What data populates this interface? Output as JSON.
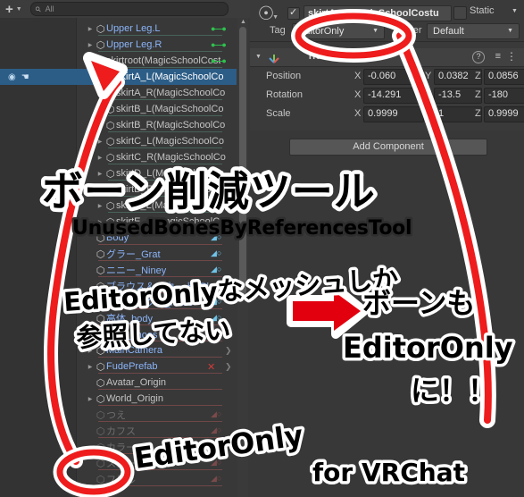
{
  "app": {
    "editor": "Unity Editor",
    "background": "#3a3a3a"
  },
  "hierarchy": {
    "toolbar": {
      "add_label": "+",
      "add_caret": "▼",
      "search_placeholder": "All",
      "search_value": ""
    },
    "scroll": {
      "up_arrow": "▲"
    },
    "rows": [
      {
        "label": "Upper Leg.L",
        "indent": 1,
        "tri": "▶",
        "color": "blue",
        "badge": "bone",
        "line": "teal"
      },
      {
        "label": "Upper Leg.R",
        "indent": 1,
        "tri": "▶",
        "color": "blue",
        "badge": "bone",
        "line": "teal"
      },
      {
        "label": "skirtroot(MagicSchoolCost",
        "indent": 1,
        "tri": "▼",
        "color": "normal",
        "badge": "bone",
        "line": "teal"
      },
      {
        "label": "skirtA_L(MagicSchoolCo",
        "indent": 2,
        "tri": "",
        "color": "selected",
        "badge": "",
        "line": "teal"
      },
      {
        "label": "skirtA_R(MagicSchoolCo",
        "indent": 2,
        "tri": "",
        "color": "normal",
        "badge": "",
        "line": "teal"
      },
      {
        "label": "skirtB_L(MagicSchoolCo",
        "indent": 2,
        "tri": "",
        "color": "normal",
        "badge": "",
        "line": "teal"
      },
      {
        "label": "skirtB_R(MagicSchoolCo",
        "indent": 2,
        "tri": "▶",
        "color": "normal",
        "badge": "",
        "line": "teal"
      },
      {
        "label": "skirtC_L(MagicSchoolCo",
        "indent": 2,
        "tri": "▶",
        "color": "normal",
        "badge": "",
        "line": "teal"
      },
      {
        "label": "skirtC_R(MagicSchoolCo",
        "indent": 2,
        "tri": "▶",
        "color": "normal",
        "badge": "",
        "line": "teal"
      },
      {
        "label": "skirtD_L(MagicSchoolCo",
        "indent": 2,
        "tri": "▶",
        "color": "normal",
        "badge": "",
        "line": "teal"
      },
      {
        "label": "skirtD_R(MagicSchoolCo",
        "indent": 2,
        "tri": "▶",
        "color": "normal",
        "badge": "",
        "line": "teal"
      },
      {
        "label": "skirtE_L(MagicSchoolCo",
        "indent": 2,
        "tri": "▶",
        "color": "normal",
        "badge": "",
        "line": "teal"
      },
      {
        "label": "skirtE_R(MagicSchoolCo",
        "indent": 2,
        "tri": "▶",
        "color": "normal",
        "badge": "",
        "line": "teal"
      },
      {
        "label": "Body",
        "indent": 1,
        "tri": "",
        "color": "blue",
        "badge": "skin",
        "line": "red"
      },
      {
        "label": "グラー_Grat",
        "indent": 1,
        "tri": "",
        "color": "blue",
        "badge": "skin",
        "line": "red"
      },
      {
        "label": "ニニー_Niney",
        "indent": 1,
        "tri": "",
        "color": "blue",
        "badge": "skin",
        "line": "red"
      },
      {
        "label": "ブラウス＆スカート_Blouse&s",
        "indent": 1,
        "tri": "",
        "color": "blue",
        "badge": "skin",
        "line": "red"
      },
      {
        "label": "ニーソックス_Knee",
        "indent": 1,
        "tri": "",
        "color": "blue",
        "badge": "skin",
        "line": "red"
      },
      {
        "label": "高体_body",
        "indent": 1,
        "tri": "",
        "color": "blue",
        "badge": "skin",
        "line": "red"
      },
      {
        "label": "座靴_shoes",
        "indent": 1,
        "tri": "",
        "color": "blue",
        "badge": "skin",
        "line": "red"
      },
      {
        "label": "MainCamera",
        "indent": 1,
        "tri": "▶",
        "color": "blue",
        "badge": "chevron",
        "line": "red"
      },
      {
        "label": "FudePrefab",
        "indent": 1,
        "tri": "▶",
        "color": "blue",
        "badge": "x-chevron",
        "line": "red"
      },
      {
        "label": "Avatar_Origin",
        "indent": 1,
        "tri": "",
        "color": "normal",
        "badge": "",
        "line": "red"
      },
      {
        "label": "World_Origin",
        "indent": 1,
        "tri": "▶",
        "color": "normal",
        "badge": "",
        "line": "red"
      },
      {
        "label": "つえ",
        "indent": 1,
        "tri": "",
        "color": "off",
        "badge": "skin-off",
        "line": "red"
      },
      {
        "label": "カフス",
        "indent": 1,
        "tri": "",
        "color": "off",
        "badge": "skin-off",
        "line": "red"
      },
      {
        "label": "カラー",
        "indent": 1,
        "tri": "",
        "color": "off",
        "badge": "skin-off",
        "line": "red"
      },
      {
        "label": "スカート",
        "indent": 1,
        "tri": "",
        "color": "off",
        "badge": "skin-off",
        "line": "red"
      },
      {
        "label": "フリル",
        "indent": 1,
        "tri": "",
        "color": "off",
        "badge": "skin-off",
        "line": "red"
      }
    ]
  },
  "inspector": {
    "gameobject_icon": "cube-icon",
    "enabled_checked": true,
    "name_value": "skirtA_L(MagicSchoolCostu",
    "static_label": "Static",
    "static_caret": "▼",
    "tag_label": "Tag",
    "tag_value": "EditorOnly",
    "layer_label": "Layer",
    "layer_value": "Default",
    "transform": {
      "title": "Transform",
      "tri": "▼",
      "help_icon": "?",
      "preset_icon": "preset-icon",
      "menu_icon": "⋮",
      "rows": [
        {
          "name": "Position",
          "x": "-0.060",
          "y": "0.0382",
          "z": "0.0856"
        },
        {
          "name": "Rotation",
          "x": "-14.291",
          "y": "-13.5",
          "z": "-180"
        },
        {
          "name": "Scale",
          "x": "0.9999",
          "y": "1",
          "z": "0.9999"
        }
      ],
      "axis_labels": [
        "X",
        "Y",
        "Z"
      ]
    },
    "add_component_label": "Add Component"
  },
  "annotations": {
    "title_main": "ボーン削減ツール",
    "title_sub": "UnusedBonesByReferencesTool",
    "note_left_line1": "EditorOnlyなメッシュしか",
    "note_left_line2": "参照してない",
    "arrow_glyph": "➡",
    "note_right_line1": "ボーンも",
    "note_right_line2": "EditorOnly",
    "note_right_line3": "に！！",
    "note_bottom": "EditorOnly",
    "footer": "for VRChat",
    "colors": {
      "orange": "#f26522",
      "red": "#e8161a",
      "white": "#ffffff",
      "vrchat_orange": "#f7941e",
      "selection_blue": "#2c5d87",
      "bone_green": "#2fc14e",
      "skin_blue": "#6fc3e8"
    }
  }
}
